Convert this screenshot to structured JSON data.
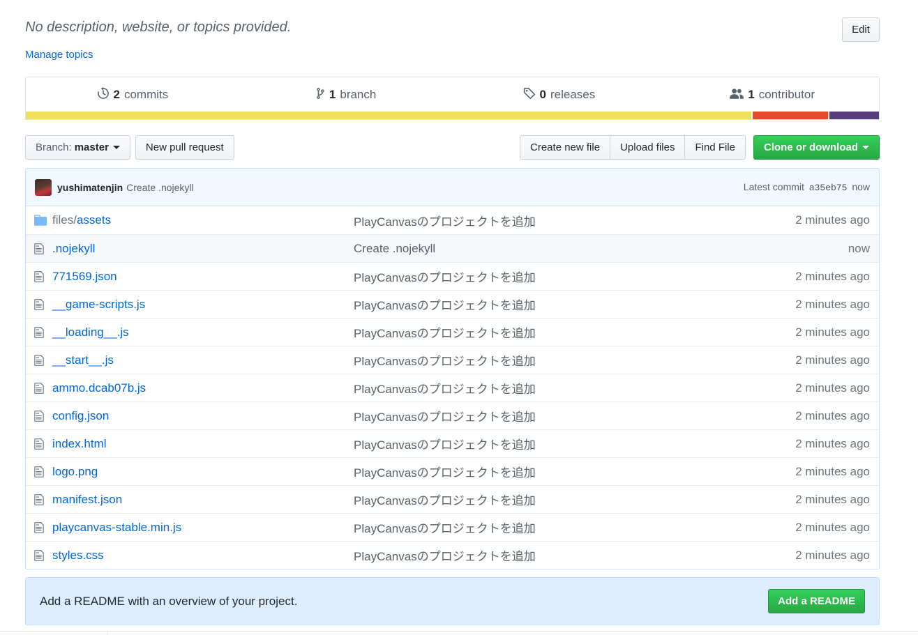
{
  "repo": {
    "description": "No description, website, or topics provided.",
    "manage_topics": "Manage topics",
    "edit_label": "Edit"
  },
  "summary": {
    "commits": {
      "count": "2",
      "label": "commits",
      "icon": "history-icon"
    },
    "branches": {
      "count": "1",
      "label": "branch",
      "icon": "branch-icon"
    },
    "releases": {
      "count": "0",
      "label": "releases",
      "icon": "tag-icon"
    },
    "contributors": {
      "count": "1",
      "label": "contributor",
      "icon": "people-icon"
    },
    "languages": [
      {
        "color": "#f1e05a",
        "percent": 85
      },
      {
        "color": "#e34c26",
        "percent": 9
      },
      {
        "color": "#563d7c",
        "percent": 6
      }
    ]
  },
  "toolbar": {
    "branch_label": "Branch:",
    "branch_value": "master",
    "new_pr": "New pull request",
    "create_file": "Create new file",
    "upload_files": "Upload files",
    "find_file": "Find File",
    "clone": "Clone or download"
  },
  "commit": {
    "author": "yushimatenjin",
    "message": "Create .nojekyll",
    "latest_label": "Latest commit",
    "sha": "a35eb75",
    "time": "now"
  },
  "files": [
    {
      "type": "dir",
      "prefix": "files/",
      "name": "assets",
      "message": "PlayCanvasのプロジェクトを追加",
      "age": "2 minutes ago"
    },
    {
      "type": "file",
      "prefix": "",
      "name": ".nojekyll",
      "message": "Create .nojekyll",
      "age": "now"
    },
    {
      "type": "file",
      "prefix": "",
      "name": "771569.json",
      "message": "PlayCanvasのプロジェクトを追加",
      "age": "2 minutes ago"
    },
    {
      "type": "file",
      "prefix": "",
      "name": "__game-scripts.js",
      "message": "PlayCanvasのプロジェクトを追加",
      "age": "2 minutes ago"
    },
    {
      "type": "file",
      "prefix": "",
      "name": "__loading__.js",
      "message": "PlayCanvasのプロジェクトを追加",
      "age": "2 minutes ago"
    },
    {
      "type": "file",
      "prefix": "",
      "name": "__start__.js",
      "message": "PlayCanvasのプロジェクトを追加",
      "age": "2 minutes ago"
    },
    {
      "type": "file",
      "prefix": "",
      "name": "ammo.dcab07b.js",
      "message": "PlayCanvasのプロジェクトを追加",
      "age": "2 minutes ago"
    },
    {
      "type": "file",
      "prefix": "",
      "name": "config.json",
      "message": "PlayCanvasのプロジェクトを追加",
      "age": "2 minutes ago"
    },
    {
      "type": "file",
      "prefix": "",
      "name": "index.html",
      "message": "PlayCanvasのプロジェクトを追加",
      "age": "2 minutes ago"
    },
    {
      "type": "file",
      "prefix": "",
      "name": "logo.png",
      "message": "PlayCanvasのプロジェクトを追加",
      "age": "2 minutes ago"
    },
    {
      "type": "file",
      "prefix": "",
      "name": "manifest.json",
      "message": "PlayCanvasのプロジェクトを追加",
      "age": "2 minutes ago"
    },
    {
      "type": "file",
      "prefix": "",
      "name": "playcanvas-stable.min.js",
      "message": "PlayCanvasのプロジェクトを追加",
      "age": "2 minutes ago"
    },
    {
      "type": "file",
      "prefix": "",
      "name": "styles.css",
      "message": "PlayCanvasのプロジェクトを追加",
      "age": "2 minutes ago"
    }
  ],
  "readme": {
    "text": "Add a README with an overview of your project.",
    "button": "Add a README"
  },
  "colors": {
    "link": "#0366d6",
    "green": "#28a745",
    "commit_bg": "#f1f8ff",
    "readme_bg": "#dbedff"
  }
}
